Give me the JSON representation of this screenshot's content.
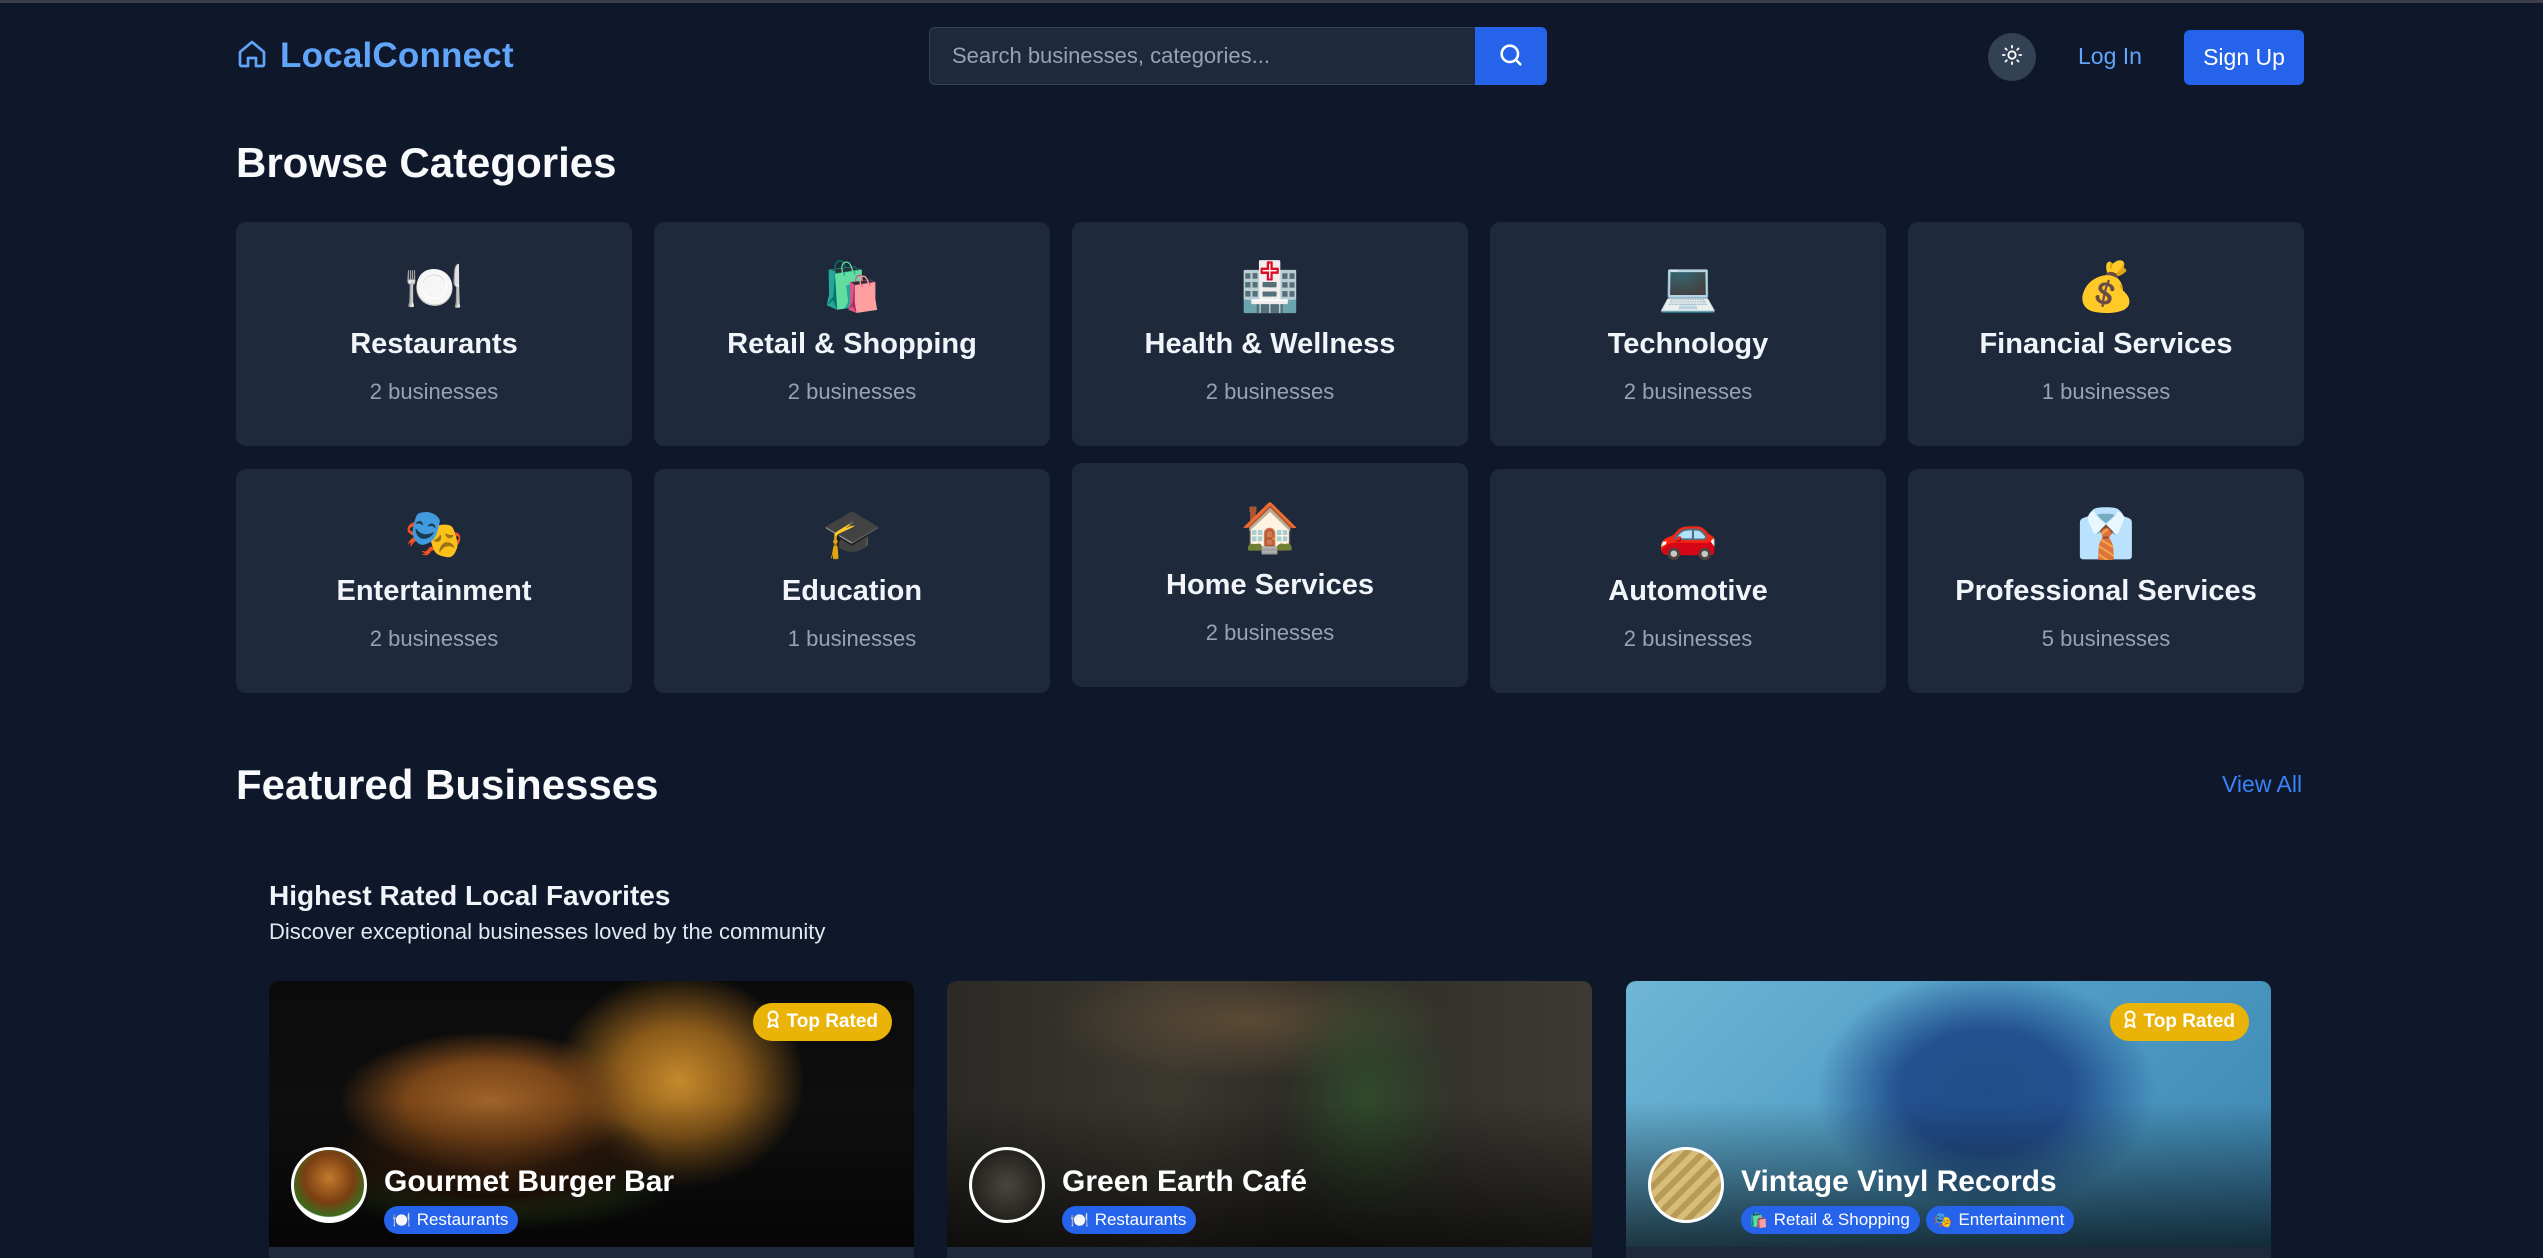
{
  "header": {
    "brand": "LocalConnect",
    "search_placeholder": "Search businesses, categories...",
    "login_label": "Log In",
    "signup_label": "Sign Up",
    "icons": {
      "logo": "home-icon",
      "search": "search-icon",
      "theme": "sun-icon"
    }
  },
  "categories": {
    "title": "Browse Categories",
    "items": [
      {
        "name": "Restaurants",
        "count": "2 businesses",
        "icon": "🍽️"
      },
      {
        "name": "Retail & Shopping",
        "count": "2 businesses",
        "icon": "🛍️"
      },
      {
        "name": "Health & Wellness",
        "count": "2 businesses",
        "icon": "🏥"
      },
      {
        "name": "Technology",
        "count": "2 businesses",
        "icon": "💻"
      },
      {
        "name": "Financial Services",
        "count": "1 businesses",
        "icon": "💰"
      },
      {
        "name": "Entertainment",
        "count": "2 businesses",
        "icon": "🎭"
      },
      {
        "name": "Education",
        "count": "1 businesses",
        "icon": "🎓"
      },
      {
        "name": "Home Services",
        "count": "2 businesses",
        "icon": "🏠"
      },
      {
        "name": "Automotive",
        "count": "2 businesses",
        "icon": "🚗"
      },
      {
        "name": "Professional Services",
        "count": "5 businesses",
        "icon": "👔"
      }
    ]
  },
  "featured": {
    "title": "Featured Businesses",
    "view_all": "View All",
    "subtitle": "Highest Rated Local Favorites",
    "description": "Discover exceptional businesses loved by the community",
    "badge_label": "Top Rated",
    "businesses": [
      {
        "name": "Gourmet Burger Bar",
        "top_rated": true,
        "tags": [
          {
            "label": "Restaurants",
            "icon": "🍽️"
          }
        ]
      },
      {
        "name": "Green Earth Café",
        "top_rated": false,
        "tags": [
          {
            "label": "Restaurants",
            "icon": "🍽️"
          }
        ]
      },
      {
        "name": "Vintage Vinyl Records",
        "top_rated": true,
        "tags": [
          {
            "label": "Retail & Shopping",
            "icon": "🛍️"
          },
          {
            "label": "Entertainment",
            "icon": "🎭"
          }
        ]
      }
    ]
  },
  "colors": {
    "background": "#0f172a",
    "card": "#1e293b",
    "accent": "#2563eb",
    "brand": "#60a5fa",
    "badge": "#eab308"
  }
}
